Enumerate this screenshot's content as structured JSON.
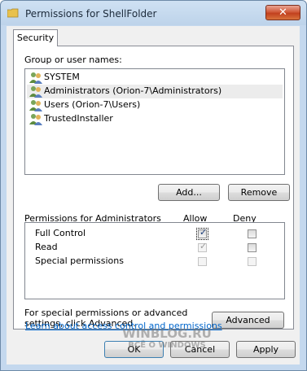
{
  "window": {
    "title": "Permissions for ShellFolder"
  },
  "tabs": [
    {
      "label": "Security"
    }
  ],
  "groups": {
    "label": "Group or user names:",
    "items": [
      {
        "label": "SYSTEM"
      },
      {
        "label": "Administrators (Orion-7\\Administrators)"
      },
      {
        "label": "Users (Orion-7\\Users)"
      },
      {
        "label": "TrustedInstaller"
      }
    ]
  },
  "buttons": {
    "add": "Add...",
    "remove": "Remove",
    "advanced": "Advanced",
    "ok": "OK",
    "cancel": "Cancel",
    "apply": "Apply"
  },
  "permissions": {
    "label": "Permissions for Administrators",
    "allow_header": "Allow",
    "deny_header": "Deny",
    "rows": [
      {
        "name": "Full Control",
        "allow": true,
        "deny": false
      },
      {
        "name": "Read",
        "allow": true,
        "deny": false
      },
      {
        "name": "Special permissions",
        "allow": false,
        "deny": false
      }
    ]
  },
  "special_note": "For special permissions or advanced settings, click Advanced.",
  "link": "Learn about access control and permissions",
  "watermark": {
    "line1": "WINBLOG.RU",
    "line2": "ВСЁ О WINDOWS"
  },
  "colors": {
    "link": "#0066cc",
    "close_button": "#c2401f"
  }
}
